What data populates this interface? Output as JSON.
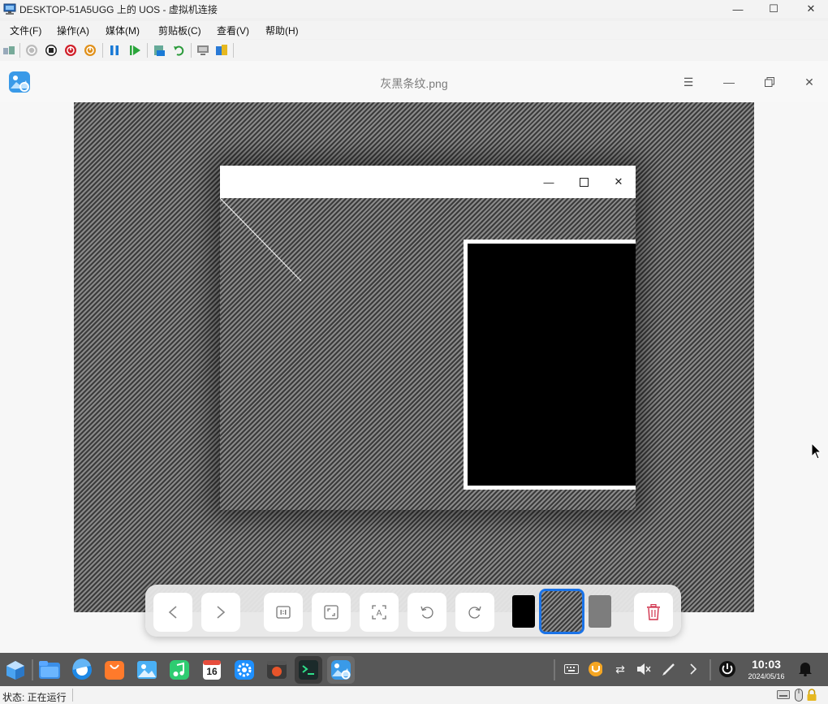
{
  "host": {
    "title": "DESKTOP-51A5UGG 上的 UOS - 虚拟机连接",
    "menu": [
      "文件(F)",
      "操作(A)",
      "媒体(M)",
      "剪贴板(C)",
      "查看(V)",
      "帮助(H)"
    ],
    "toolbar_icons": [
      "ctrl-alt-del-icon",
      "start-icon",
      "turn-off-icon",
      "shutdown-icon",
      "save-icon",
      "pause-icon",
      "resume-icon",
      "checkpoint-icon",
      "revert-icon",
      "enhanced-session-icon",
      "share-icon"
    ]
  },
  "app": {
    "file_name": "灰黑条纹.png",
    "toolbar": {
      "buttons": [
        "previous",
        "next",
        "original-size",
        "fit-window",
        "ocr",
        "rotate-left",
        "rotate-right",
        "delete"
      ],
      "thumbnails": 3,
      "selected_thumbnail": 2
    }
  },
  "taskbar": {
    "apps": [
      "launcher",
      "file-manager",
      "browser",
      "app-store",
      "image-viewer",
      "music",
      "calendar",
      "control-center",
      "screen-recorder",
      "terminal",
      "image-viewer-active"
    ],
    "calendar_day": "16",
    "time": "10:03",
    "date": "2024/05/16"
  },
  "status": {
    "text": "状态: 正在运行"
  },
  "colors": {
    "accent": "#1a73e8",
    "delete": "#d0304a",
    "stripe_dark": "#3b3b3b",
    "stripe_light": "#8a8a8a"
  }
}
